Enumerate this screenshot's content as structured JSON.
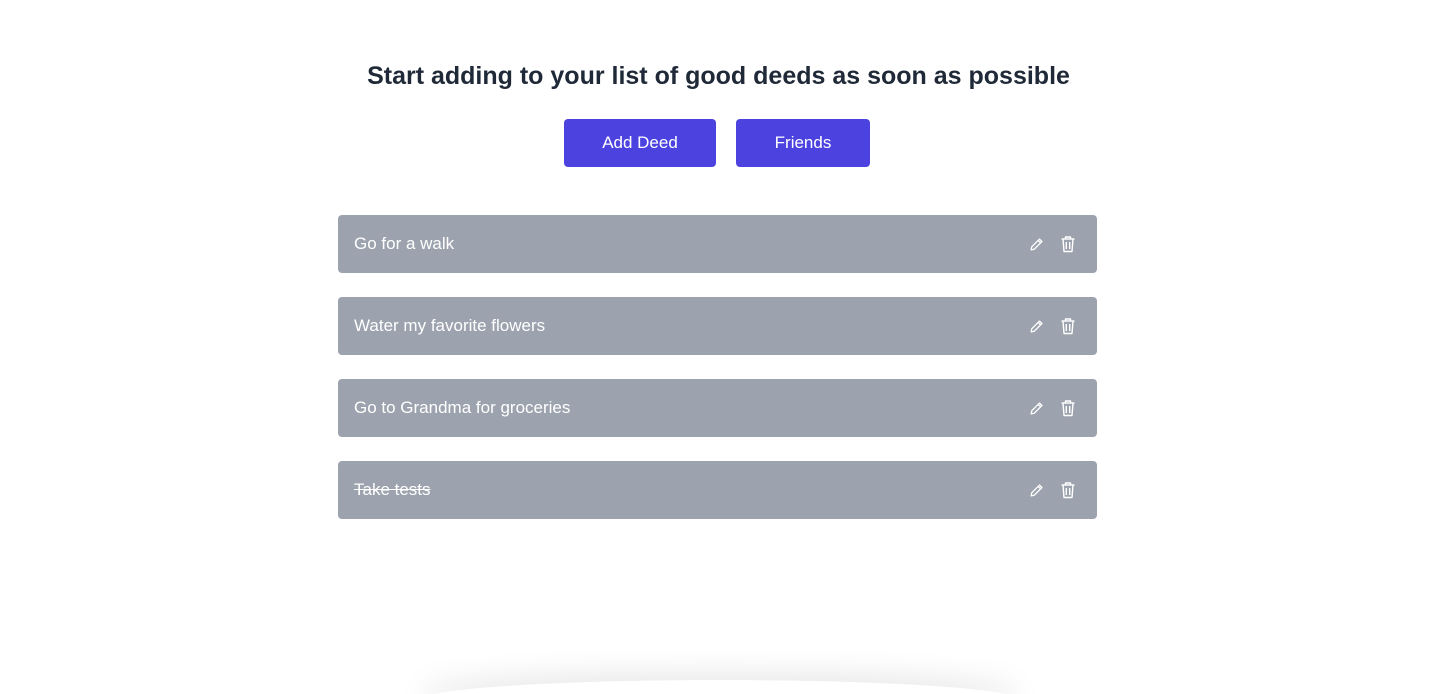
{
  "header": {
    "title": "Start adding to your list of good deeds as soon as possible"
  },
  "actions": {
    "add_label": "Add Deed",
    "friends_label": "Friends"
  },
  "deeds": [
    {
      "text": "Go for a walk",
      "completed": false
    },
    {
      "text": "Water my favorite flowers",
      "completed": false
    },
    {
      "text": "Go to Grandma for groceries",
      "completed": false
    },
    {
      "text": "Take tests",
      "completed": true
    }
  ],
  "icons": {
    "edit": "pencil-icon",
    "delete": "trash-icon"
  },
  "colors": {
    "accent": "#4c42e0",
    "item_bg": "#9ca3ae",
    "title": "#1f2937"
  }
}
